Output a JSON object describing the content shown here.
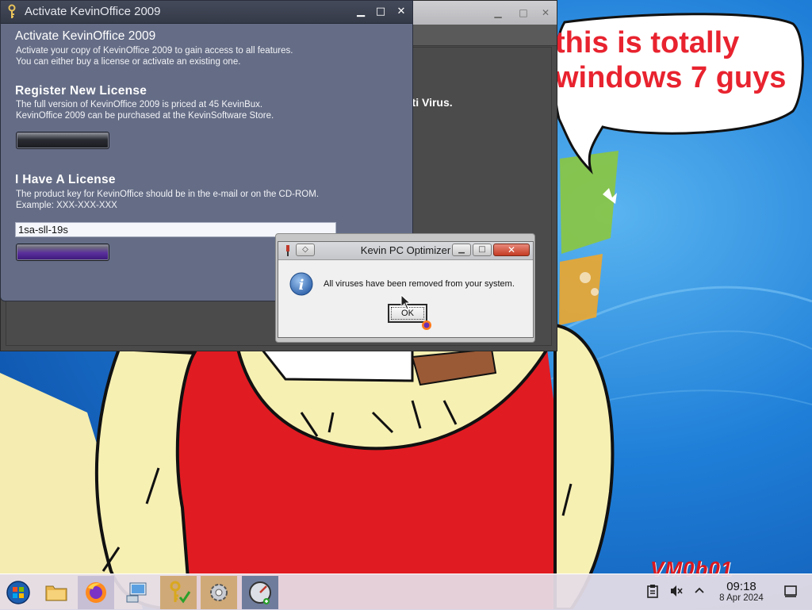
{
  "desktop": {
    "speech_line1": "this is totally",
    "speech_line2": "windows 7 guys",
    "watermark": "VM0b01"
  },
  "background_window": {
    "visible_text": "nti Virus."
  },
  "activate_window": {
    "title": "Activate KevinOffice 2009",
    "heading": "Activate KevinOffice 2009",
    "intro_line1": "Activate your copy of KevinOffice 2009 to gain access to all features.",
    "intro_line2": "You can either buy a license or activate an existing one.",
    "register_heading": "Register New License",
    "register_line1": "The full version of KevinOffice 2009 is priced at 45 KevinBux.",
    "register_line2": "KevinOffice 2009 can be purchased at the KevinSoftware Store.",
    "license_heading": "I Have A License",
    "license_line1": "The product key for KevinOffice should be in the e-mail or on the CD-ROM.",
    "license_line2": "Example: XXX-XXX-XXX",
    "product_key_value": "1sa-sll-19s",
    "controls": {
      "minimize": "▁",
      "maximize": "□",
      "close": "✕"
    }
  },
  "dialog": {
    "title": "Kevin PC Optimizer",
    "message": "All viruses have been removed from your system.",
    "ok_label": "OK",
    "icon": "info-icon"
  },
  "taskbar": {
    "items": [
      {
        "name": "start-orb-icon"
      },
      {
        "name": "file-manager-icon"
      },
      {
        "name": "firefox-icon"
      },
      {
        "name": "network-computer-icon"
      },
      {
        "name": "activation-key-icon"
      },
      {
        "name": "pc-optimizer-gear-icon"
      },
      {
        "name": "antivirus-gauge-icon"
      }
    ],
    "clock_time": "09:18",
    "clock_date": "8 Apr 2024",
    "tray": [
      "clipboard-icon",
      "speaker-muted-icon",
      "chevron-up-icon",
      "show-desktop-icon"
    ]
  },
  "colors": {
    "activate_bg": "#656d86",
    "dialog_close": "#c43b22",
    "speech_text": "#e8232f",
    "wallpaper": "#1f6fd0"
  }
}
